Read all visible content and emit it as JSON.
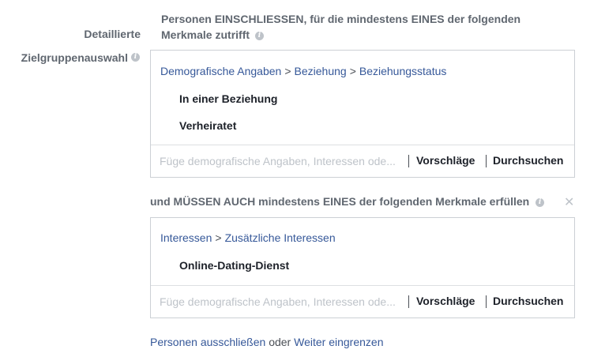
{
  "labels": {
    "detailed_line1": "Detaillierte",
    "detailed_line2": "Zielgruppenauswahl"
  },
  "include_group": {
    "heading_line1": "Personen EINSCHLIESSEN, für die mindestens EINES der folgenden",
    "heading_line2": "Merkmale zutrifft",
    "breadcrumb": [
      "Demografische Angaben",
      "Beziehung",
      "Beziehungsstatus"
    ],
    "items": [
      "In einer Beziehung",
      "Verheiratet"
    ],
    "search_placeholder": "Füge demografische Angaben, Interessen ode...",
    "suggestions_label": "Vorschläge",
    "browse_label": "Durchsuchen"
  },
  "narrow_group": {
    "heading": "und MÜSSEN AUCH mindestens EINES der folgenden Merkmale erfüllen",
    "breadcrumb": [
      "Interessen",
      "Zusätzliche Interessen"
    ],
    "items": [
      "Online-Dating-Dienst"
    ],
    "search_placeholder": "Füge demografische Angaben, Interessen ode...",
    "suggestions_label": "Vorschläge",
    "browse_label": "Durchsuchen"
  },
  "footer": {
    "exclude_link": "Personen ausschließen",
    "or_text": "oder",
    "narrow_link": "Weiter eingrenzen"
  },
  "icons": {
    "info": "info-icon",
    "close": "close-icon"
  },
  "colors": {
    "link": "#365899",
    "label": "#606770",
    "border": "#ccd0d5",
    "placeholder": "#bec3c9"
  }
}
